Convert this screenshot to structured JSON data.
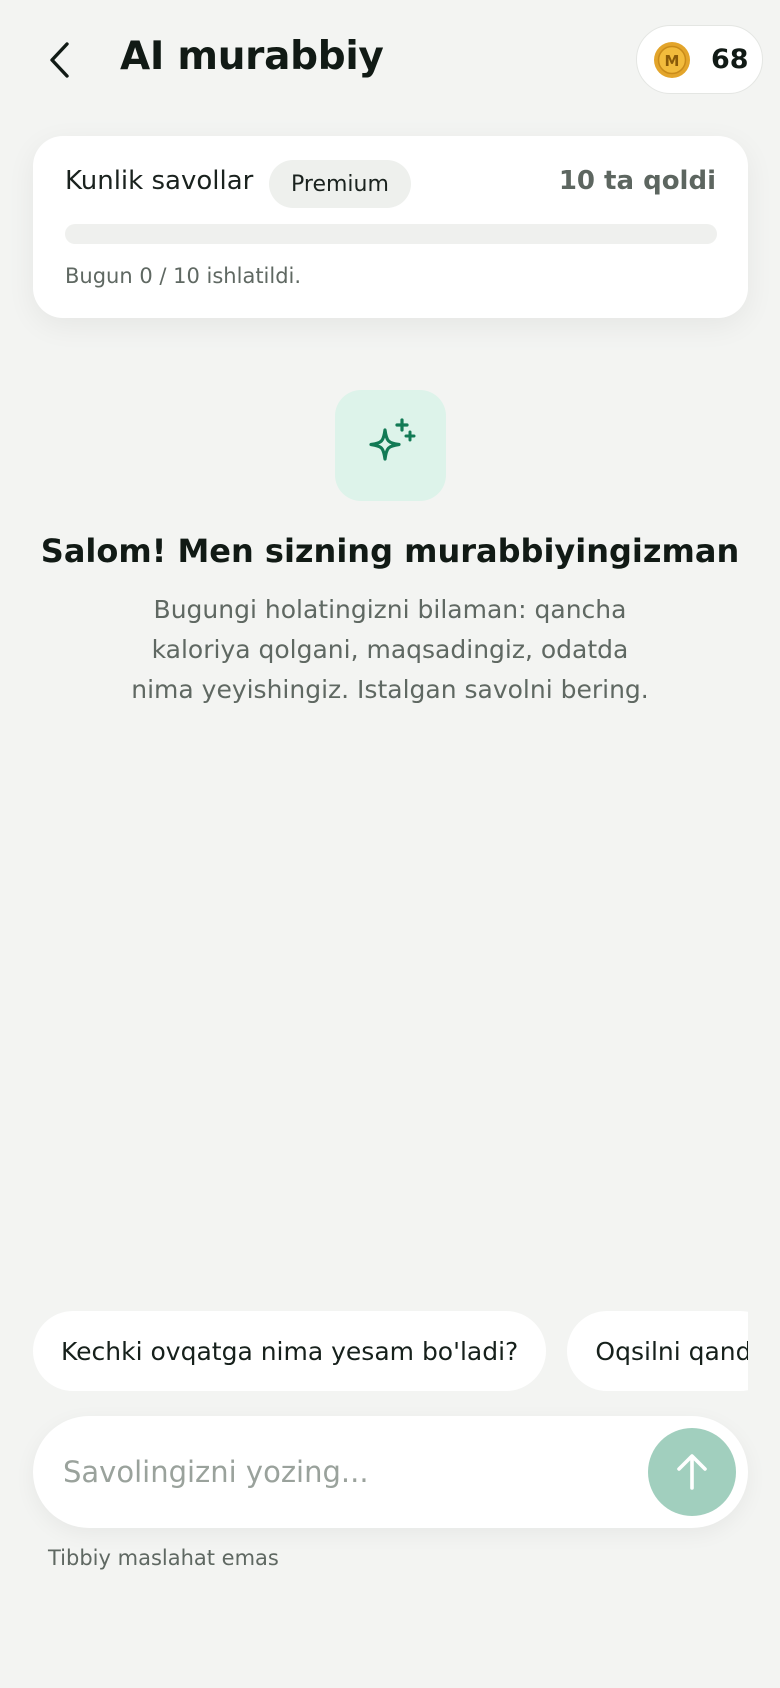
{
  "header": {
    "title": "AI murabbiy",
    "coins": {
      "icon": "coin-icon",
      "letter": "M",
      "count": "68",
      "color": "#e3a52b"
    }
  },
  "daily": {
    "label": "Kunlik savollar",
    "badge": "Premium",
    "remaining": "10 ta qoldi",
    "usage_text": "Bugun 0 / 10 ishlatildi.",
    "used": 0,
    "limit": 10,
    "progress_fraction": 0
  },
  "welcome": {
    "icon": "sparkle-icon",
    "title": "Salom! Men sizning murabbiyingizman",
    "text": "Bugungi holatingizni bilaman: qancha kaloriya qolgani, maqsadingiz, odatda nima yeyishingiz. Istalgan savolni bering."
  },
  "suggestions": [
    {
      "label": "Kechki ovqatga nima yesam bo'ladi?"
    },
    {
      "label": "Oqsilni qand"
    }
  ],
  "input": {
    "placeholder": "Savolingizni yozing...",
    "value": "",
    "send_icon": "arrow-up-icon"
  },
  "disclaimer": "Tibbiy maslahat emas",
  "colors": {
    "accent": "#127a55",
    "accent_soft": "#ddf3ea",
    "send_button": "#a1cfbe",
    "background": "#f3f4f2"
  }
}
